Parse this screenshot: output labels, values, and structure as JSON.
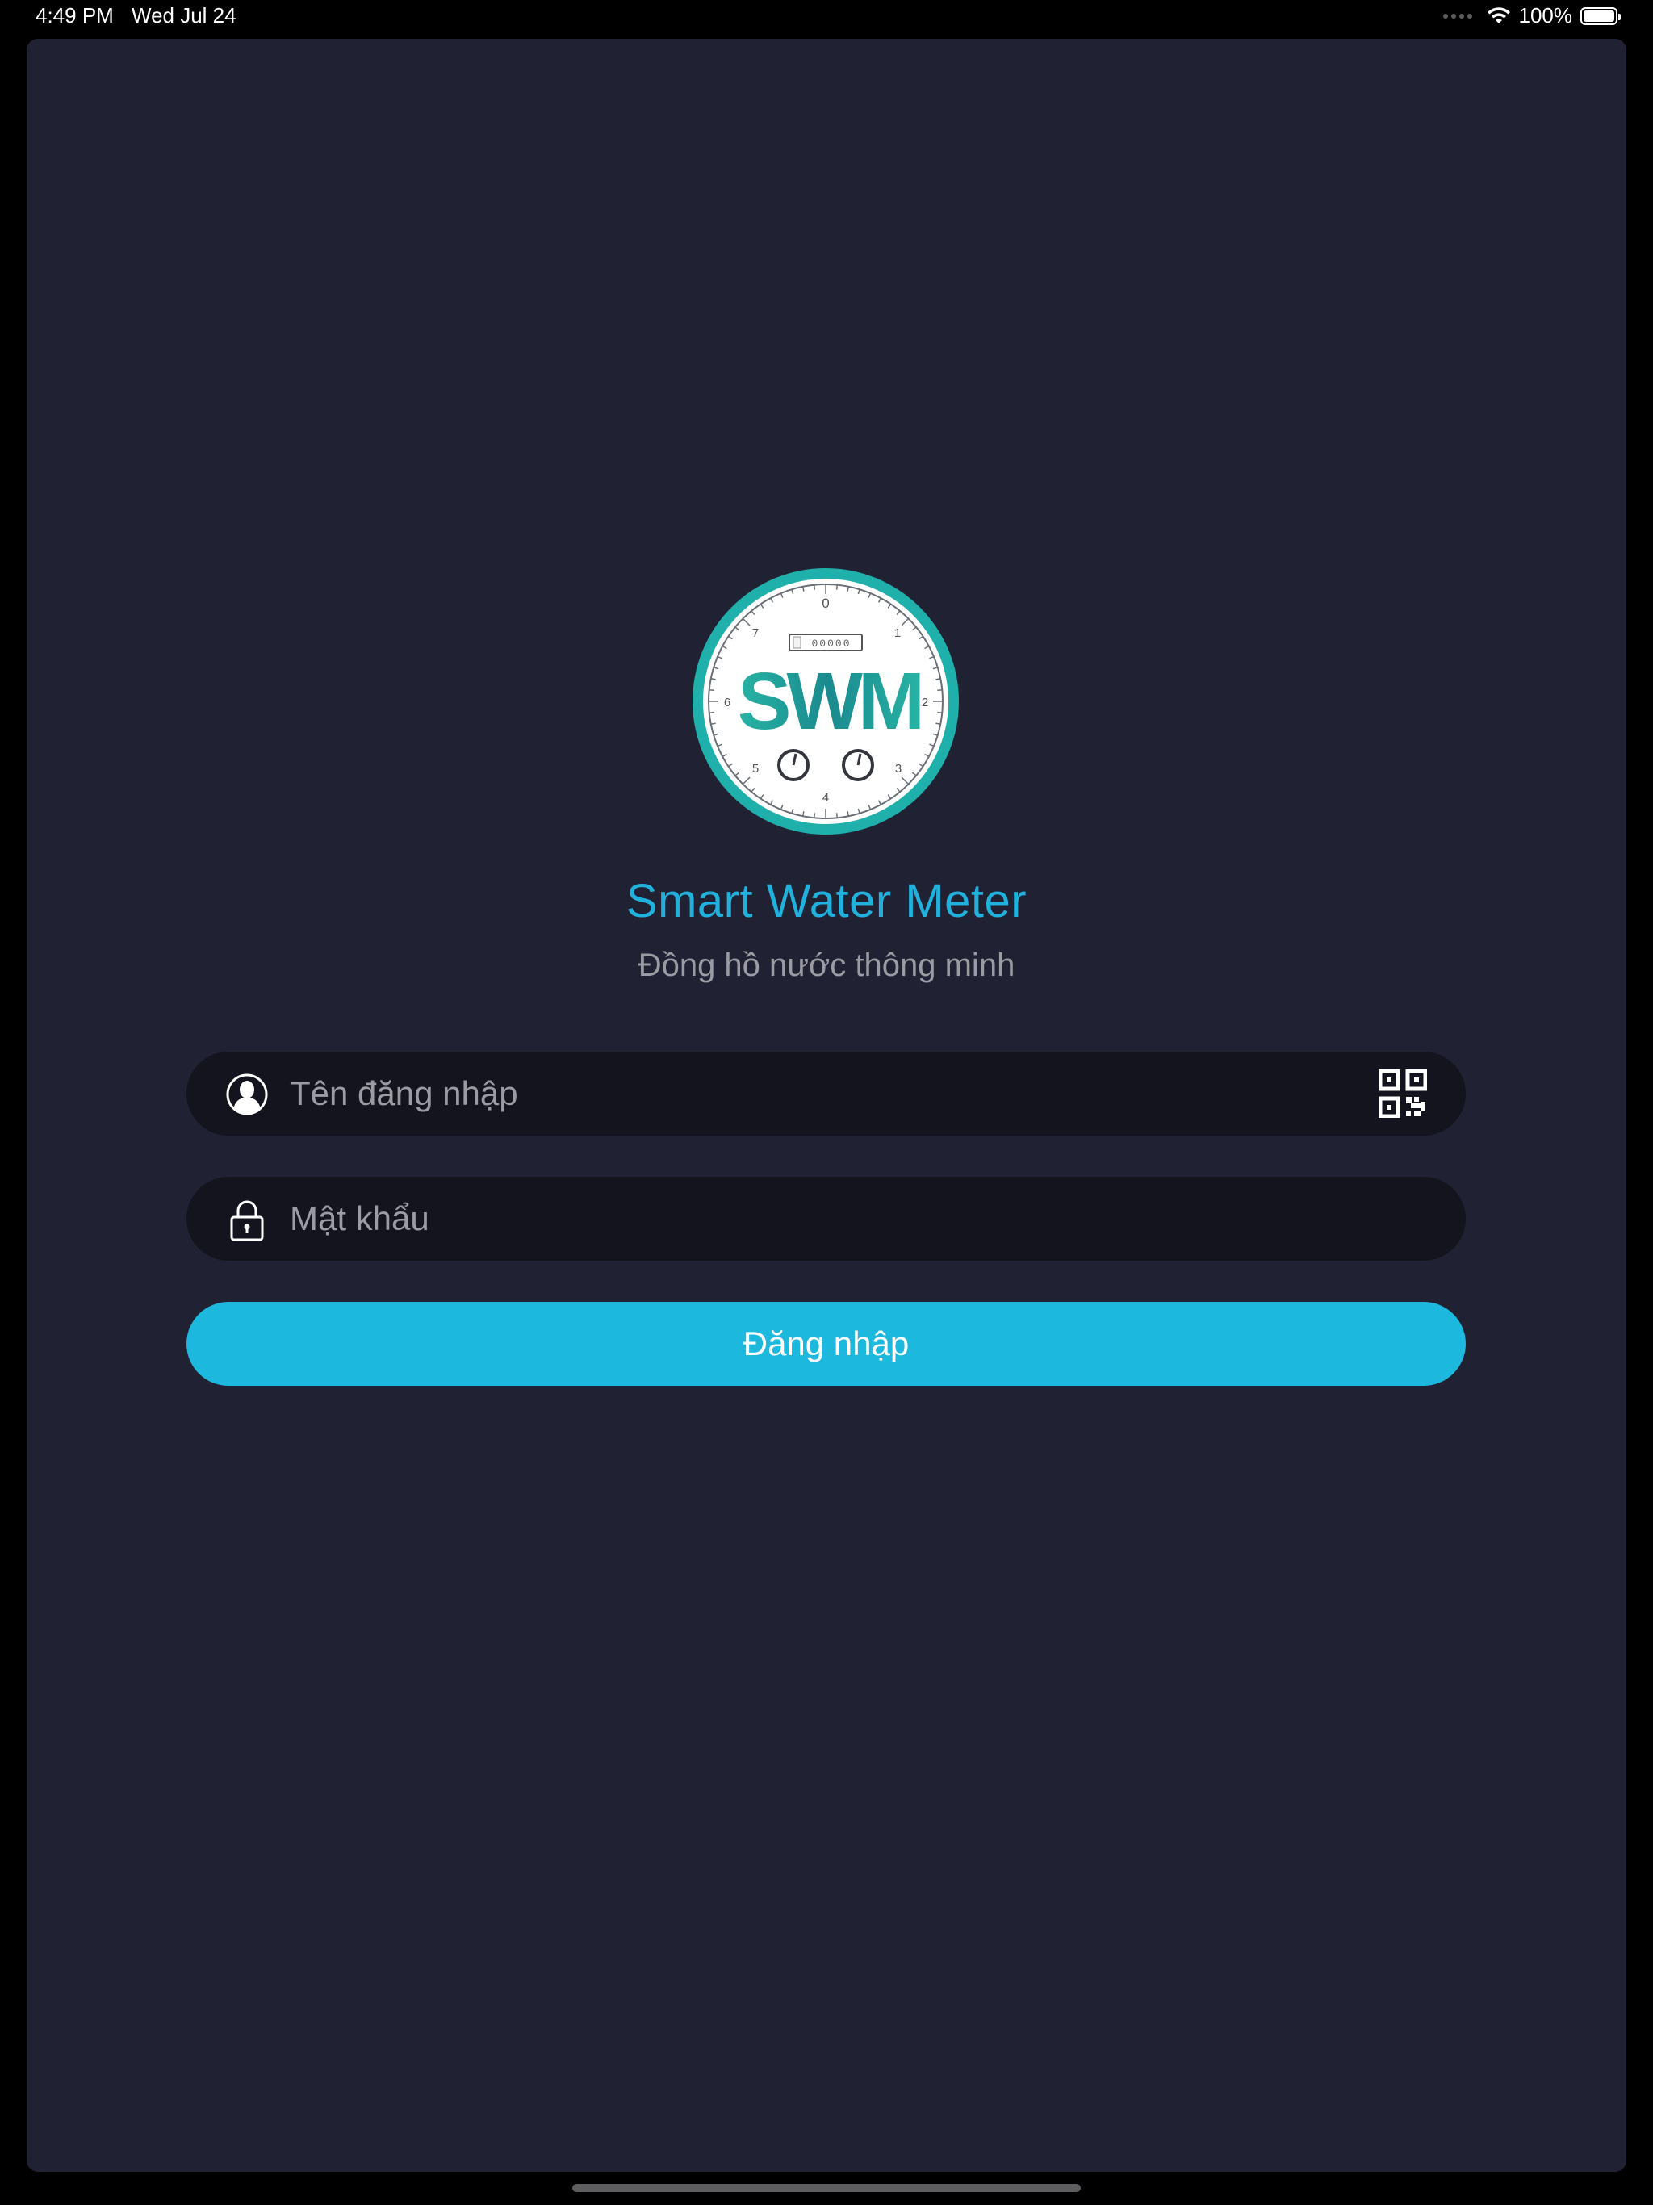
{
  "status_bar": {
    "time": "4:49 PM",
    "date": "Wed Jul 24",
    "battery": "100%",
    "icons": [
      "cellular-dots-icon",
      "wifi-icon",
      "battery-icon"
    ]
  },
  "logo": {
    "text": "SWM",
    "dial_numbers": [
      "0",
      "1",
      "2",
      "3",
      "4",
      "5",
      "6",
      "7"
    ],
    "counter": "00000"
  },
  "app": {
    "title": "Smart Water Meter",
    "subtitle": "Đồng hồ nước thông minh"
  },
  "form": {
    "username_placeholder": "Tên đăng nhập",
    "username_value": "",
    "password_placeholder": "Mật khẩu",
    "password_value": "",
    "login_label": "Đăng nhập"
  },
  "colors": {
    "background": "#202133",
    "field": "#13141d",
    "accent": "#1db8de",
    "title": "#21b1dd",
    "muted_text": "#9a9ba3"
  }
}
